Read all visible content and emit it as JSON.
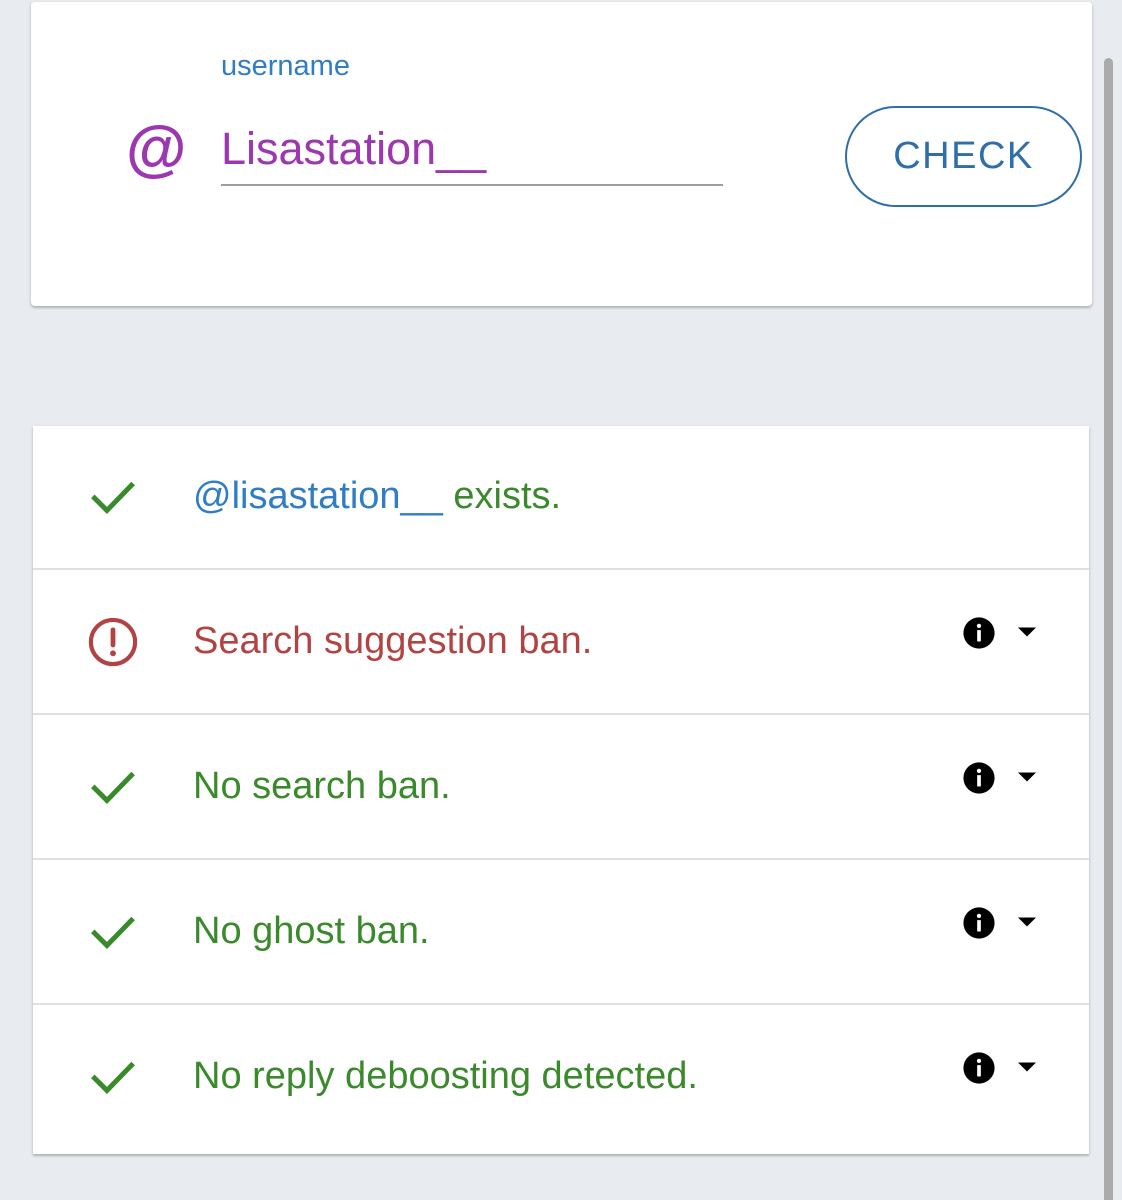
{
  "form": {
    "label": "username",
    "at_symbol": "@",
    "value": "Lisastation__",
    "button_label": "CHECK"
  },
  "results": [
    {
      "status": "ok",
      "handle": "@lisastation__",
      "text": " exists.",
      "has_details": false
    },
    {
      "status": "warning",
      "handle": "",
      "text": "Search suggestion ban.",
      "has_details": true
    },
    {
      "status": "ok",
      "handle": "",
      "text": "No search ban.",
      "has_details": true
    },
    {
      "status": "ok",
      "handle": "",
      "text": "No ghost ban.",
      "has_details": true
    },
    {
      "status": "ok",
      "handle": "",
      "text": "No reply deboosting detected.",
      "has_details": true
    }
  ],
  "colors": {
    "accent_blue": "#2f7dc4",
    "input_purple": "#9c37b0",
    "success_green": "#3a8a2c",
    "warning_red": "#b24343",
    "page_background": "#e8ebef"
  },
  "icons": {
    "ok": "check-icon",
    "warning": "alert-circle-icon",
    "details": "info-icon",
    "expand": "caret-down-icon"
  }
}
